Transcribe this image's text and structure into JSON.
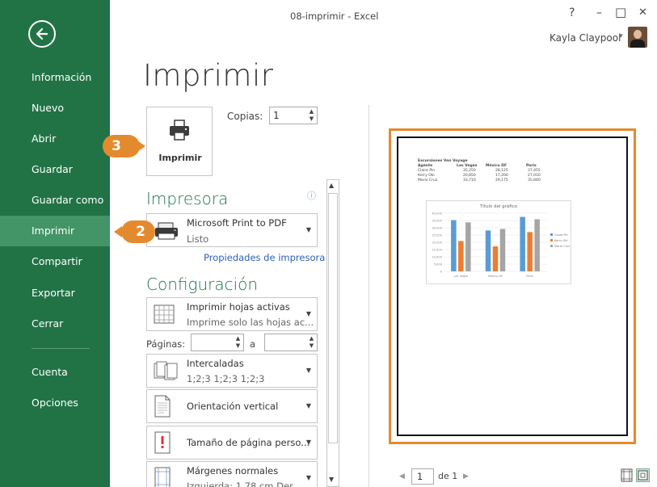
{
  "window": {
    "title": "08-imprimir - Excel",
    "help_glyph": "?",
    "minimize_glyph": "–",
    "maximize_glyph": "□",
    "close_glyph": "✕"
  },
  "user": {
    "name": "Kayla Claypool"
  },
  "sidebar": {
    "items": [
      {
        "label": "Información"
      },
      {
        "label": "Nuevo"
      },
      {
        "label": "Abrir"
      },
      {
        "label": "Guardar"
      },
      {
        "label": "Guardar como"
      },
      {
        "label": "Imprimir"
      },
      {
        "label": "Compartir"
      },
      {
        "label": "Exportar"
      },
      {
        "label": "Cerrar"
      },
      {
        "label": "Cuenta"
      },
      {
        "label": "Opciones"
      }
    ]
  },
  "main": {
    "title": "Imprimir",
    "print_button": "Imprimir",
    "copies_label": "Copias:",
    "copies_value": "1",
    "printer_section": "Impresora",
    "printer": {
      "name": "Microsoft Print to PDF",
      "status": "Listo"
    },
    "printer_properties": "Propiedades de impresora",
    "settings_section": "Configuración",
    "settings": {
      "what_title": "Imprimir hojas activas",
      "what_desc": "Imprime solo las hojas ac...",
      "pages_label": "Páginas:",
      "pages_to": "a",
      "collate_title": "Intercaladas",
      "collate_desc": "1;2;3    1;2;3    1;2;3",
      "orientation": "Orientación vertical",
      "paper": "Tamaño de página perso...",
      "margins_title": "Márgenes normales",
      "margins_desc": "Izquierda: 1,78 cm    Der..."
    }
  },
  "preview": {
    "sheet": {
      "title": "Excursiones Von Voyage",
      "headers": [
        "Agente",
        "Las Vegas",
        "México DF",
        "París"
      ],
      "rows": [
        [
          "Claire Pin",
          "35,250",
          "28,125",
          "37,455"
        ],
        [
          "Kerry Oki",
          "20,850",
          "17,200",
          "27,010"
        ],
        [
          "Mario Cruz",
          "33,710",
          "29,175",
          "35,840"
        ]
      ]
    },
    "page_current": "1",
    "page_of": "de 1"
  },
  "chart_data": {
    "type": "bar",
    "title": "Título del gráfico",
    "categories": [
      "Las Vegas",
      "México DF",
      "París"
    ],
    "series": [
      {
        "name": "Claire Pin",
        "values": [
          35250,
          28125,
          37455
        ]
      },
      {
        "name": "Kerry Oki",
        "values": [
          20850,
          17200,
          27010
        ]
      },
      {
        "name": "Mario Cruz",
        "values": [
          33710,
          29175,
          35840
        ]
      }
    ],
    "colors": [
      "#5b9bd5",
      "#ed7d31",
      "#a5a5a5"
    ],
    "yticks": [
      "40,000",
      "35,000",
      "30,000",
      "25,000",
      "20,000",
      "15,000",
      "10,000",
      "5,000",
      "0"
    ],
    "ylim": [
      0,
      40000
    ],
    "legend": "right",
    "grid": true
  },
  "callouts": {
    "step2": "2",
    "step3": "3"
  },
  "colors": {
    "backstage": "#217346",
    "active": "#439467",
    "accent": "#e48a2e",
    "link": "#2e61b3"
  }
}
